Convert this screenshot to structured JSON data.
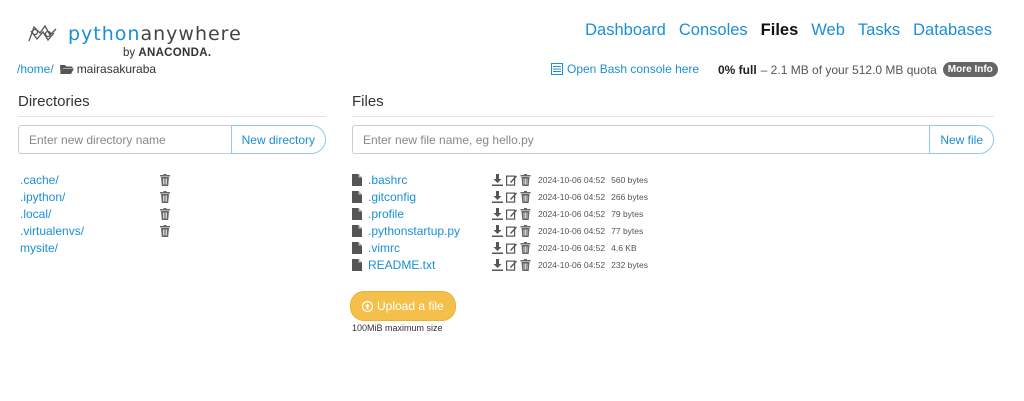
{
  "logo": {
    "prefix": "python",
    "suffix": "anywhere",
    "by_text": "by",
    "by_brand": "ANACONDA."
  },
  "breadcrumb": {
    "home": "/home/",
    "user": "mairasakuraba"
  },
  "topnav": {
    "items": [
      "Dashboard",
      "Consoles",
      "Files",
      "Web",
      "Tasks",
      "Databases"
    ],
    "active": "Files"
  },
  "bash_link": "Open Bash console here",
  "quota": {
    "percent": "0% full",
    "detail": "– 2.1 MB of your 512.0 MB quota",
    "more_info": "More Info"
  },
  "directories": {
    "title": "Directories",
    "input_placeholder": "Enter new directory name",
    "button_label": "New directory",
    "items": [
      ".cache/",
      ".ipython/",
      ".local/",
      ".virtualenvs/",
      "mysite/"
    ]
  },
  "files": {
    "title": "Files",
    "input_placeholder": "Enter new file name, eg hello.py",
    "button_label": "New file",
    "items": [
      {
        "name": ".bashrc",
        "date": "2024-10-06 04:52",
        "size": "560 bytes"
      },
      {
        "name": ".gitconfig",
        "date": "2024-10-06 04:52",
        "size": "266 bytes"
      },
      {
        "name": ".profile",
        "date": "2024-10-06 04:52",
        "size": "79 bytes"
      },
      {
        "name": ".pythonstartup.py",
        "date": "2024-10-06 04:52",
        "size": "77 bytes"
      },
      {
        "name": ".vimrc",
        "date": "2024-10-06 04:52",
        "size": "4.6 KB"
      },
      {
        "name": "README.txt",
        "date": "2024-10-06 04:52",
        "size": "232 bytes"
      }
    ]
  },
  "upload": {
    "button_label": "Upload a file",
    "note": "100MiB maximum size"
  },
  "colors": {
    "link": "#1a8fd6",
    "upload": "#f4c04a",
    "badge": "#666666"
  }
}
